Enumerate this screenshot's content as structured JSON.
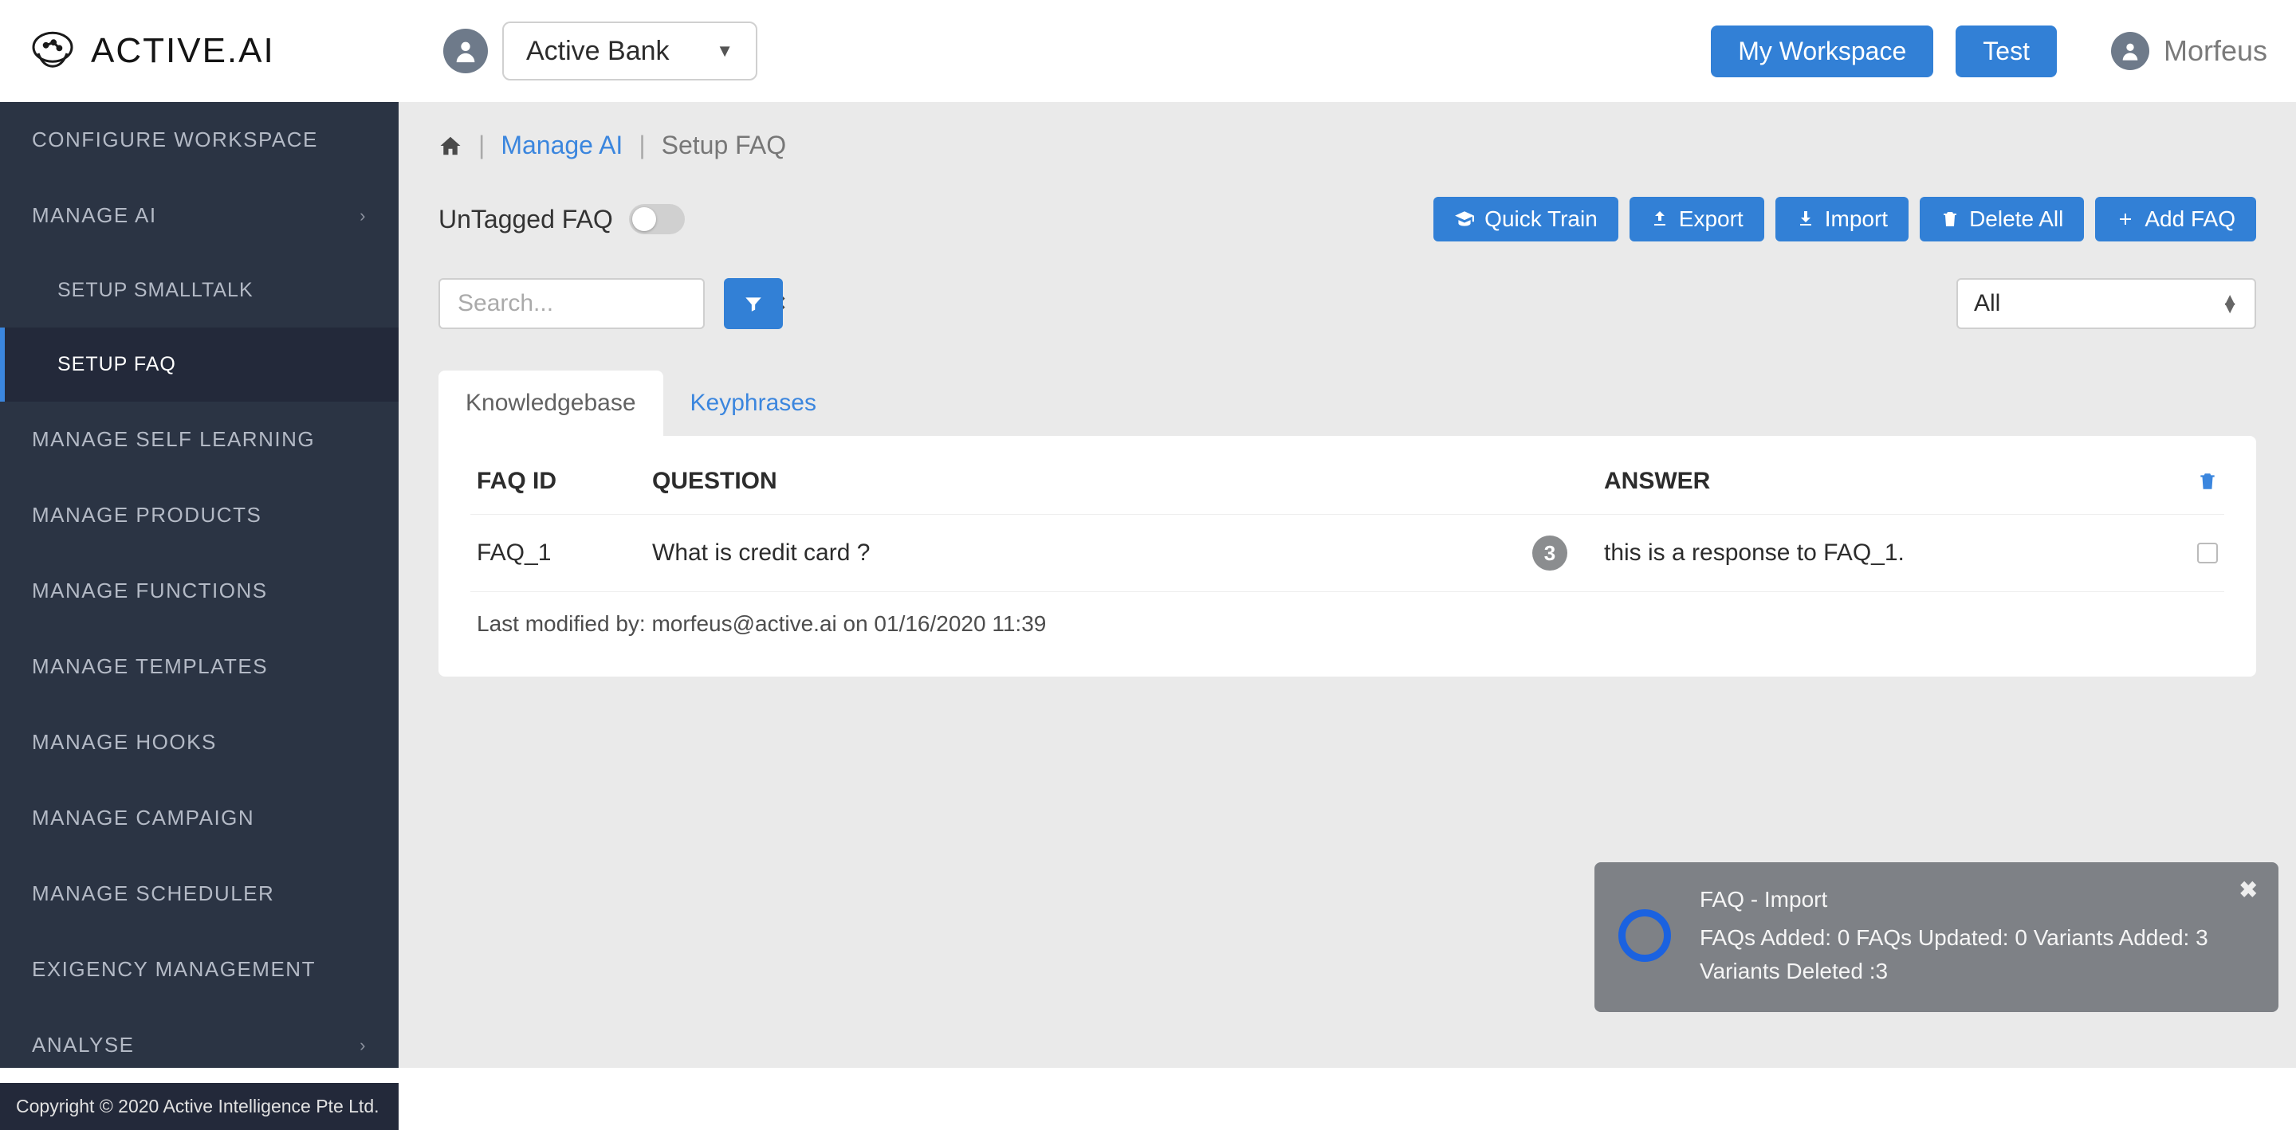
{
  "brand": {
    "name": "ACTIVE.AI"
  },
  "header": {
    "workspace_selected": "Active Bank",
    "my_workspace_btn": "My Workspace",
    "test_btn": "Test",
    "user_name": "Morfeus"
  },
  "sidebar": {
    "items": [
      {
        "label": "CONFIGURE WORKSPACE"
      },
      {
        "label": "MANAGE AI",
        "has_sub": true
      },
      {
        "label": "SETUP SMALLTALK",
        "sub": true
      },
      {
        "label": "SETUP FAQ",
        "sub": true,
        "active": true
      },
      {
        "label": "MANAGE SELF LEARNING"
      },
      {
        "label": "MANAGE PRODUCTS"
      },
      {
        "label": "MANAGE FUNCTIONS"
      },
      {
        "label": "MANAGE TEMPLATES"
      },
      {
        "label": "MANAGE HOOKS"
      },
      {
        "label": "MANAGE CAMPAIGN"
      },
      {
        "label": "MANAGE SCHEDULER"
      },
      {
        "label": "EXIGENCY MANAGEMENT"
      },
      {
        "label": "ANALYSE",
        "has_sub": true
      }
    ],
    "copyright": "Copyright © 2020 Active Intelligence Pte Ltd."
  },
  "breadcrumb": {
    "link": "Manage AI",
    "current": "Setup FAQ"
  },
  "toolbar": {
    "toggle_label": "UnTagged FAQ",
    "quick_train": "Quick Train",
    "export": "Export",
    "import": "Import",
    "delete_all": "Delete All",
    "add_faq": "Add FAQ"
  },
  "search": {
    "placeholder": "Search...",
    "filter_selected": "All"
  },
  "tabs": {
    "knowledgebase": "Knowledgebase",
    "keyphrases": "Keyphrases"
  },
  "table": {
    "headers": {
      "faq_id": "FAQ ID",
      "question": "QUESTION",
      "answer": "ANSWER"
    },
    "rows": [
      {
        "faq_id": "FAQ_1",
        "question": "What is credit card ?",
        "count": "3",
        "answer": "this is a response to FAQ_1."
      }
    ],
    "modified": "Last modified by: morfeus@active.ai on 01/16/2020 11:39"
  },
  "toast": {
    "title": "FAQ - Import",
    "body": "FAQs Added: 0 FAQs Updated: 0 Variants Added: 3 Variants Deleted :3"
  }
}
